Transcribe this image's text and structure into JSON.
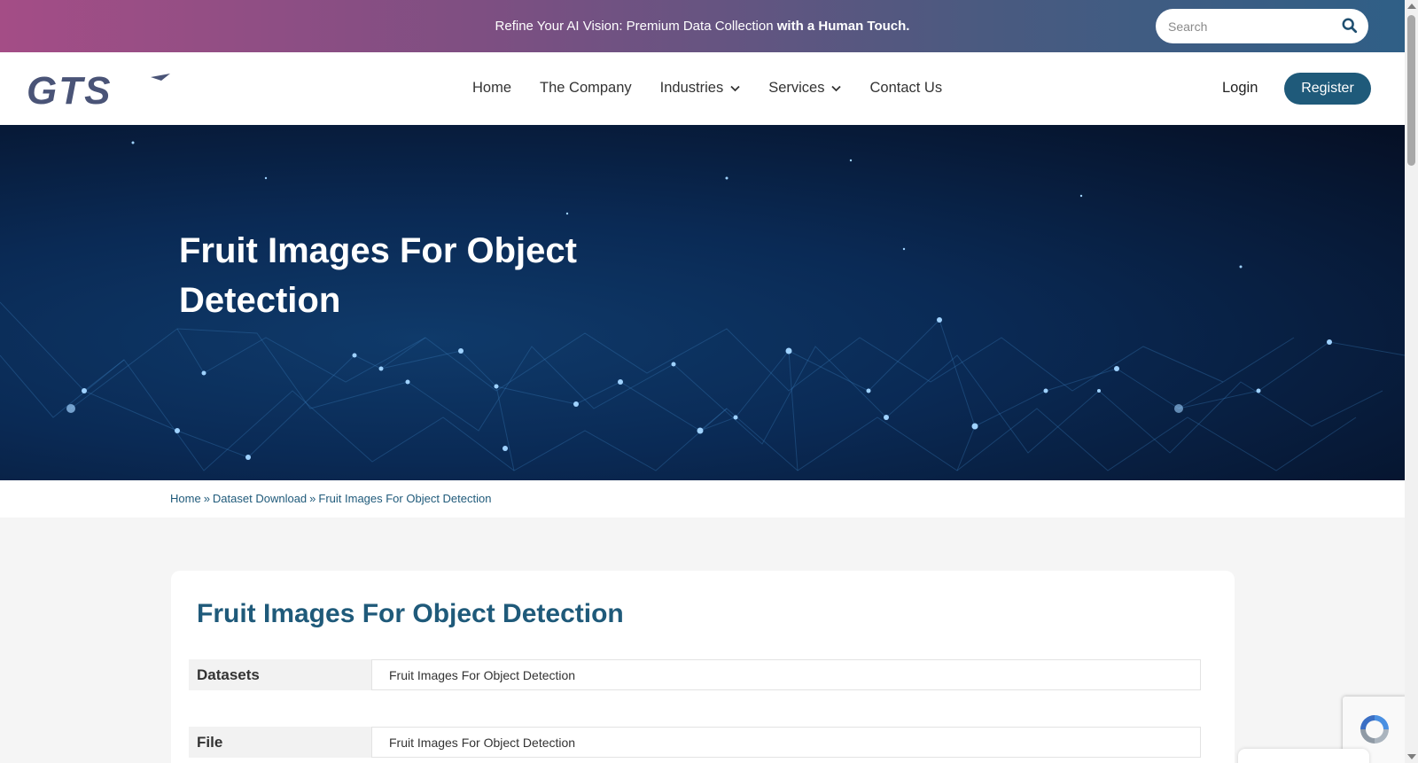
{
  "topbar": {
    "promo_text": "Refine Your AI Vision: Premium Data Collection ",
    "promo_bold": "with a Human Touch.",
    "search_placeholder": "Search"
  },
  "nav": {
    "logo_text": "GTS",
    "items": [
      {
        "label": "Home",
        "has_dropdown": false
      },
      {
        "label": "The Company",
        "has_dropdown": false
      },
      {
        "label": "Industries",
        "has_dropdown": true
      },
      {
        "label": "Services",
        "has_dropdown": true
      },
      {
        "label": "Contact Us",
        "has_dropdown": false
      }
    ],
    "login_label": "Login",
    "register_label": "Register"
  },
  "hero": {
    "title": "Fruit Images For Object Detection"
  },
  "breadcrumb": {
    "items": [
      "Home",
      "Dataset Download",
      "Fruit Images For Object Detection"
    ],
    "separator": "»"
  },
  "card": {
    "title": "Fruit Images For Object Detection",
    "rows": [
      {
        "key": "Datasets",
        "value": "Fruit Images For Object Detection"
      },
      {
        "key": "File",
        "value": "Fruit Images For Object Detection"
      }
    ]
  },
  "colors": {
    "brand": "#1f5a7a",
    "topbar_start": "#a44d86",
    "topbar_end": "#2f5f86",
    "logo": "#4a5477"
  }
}
